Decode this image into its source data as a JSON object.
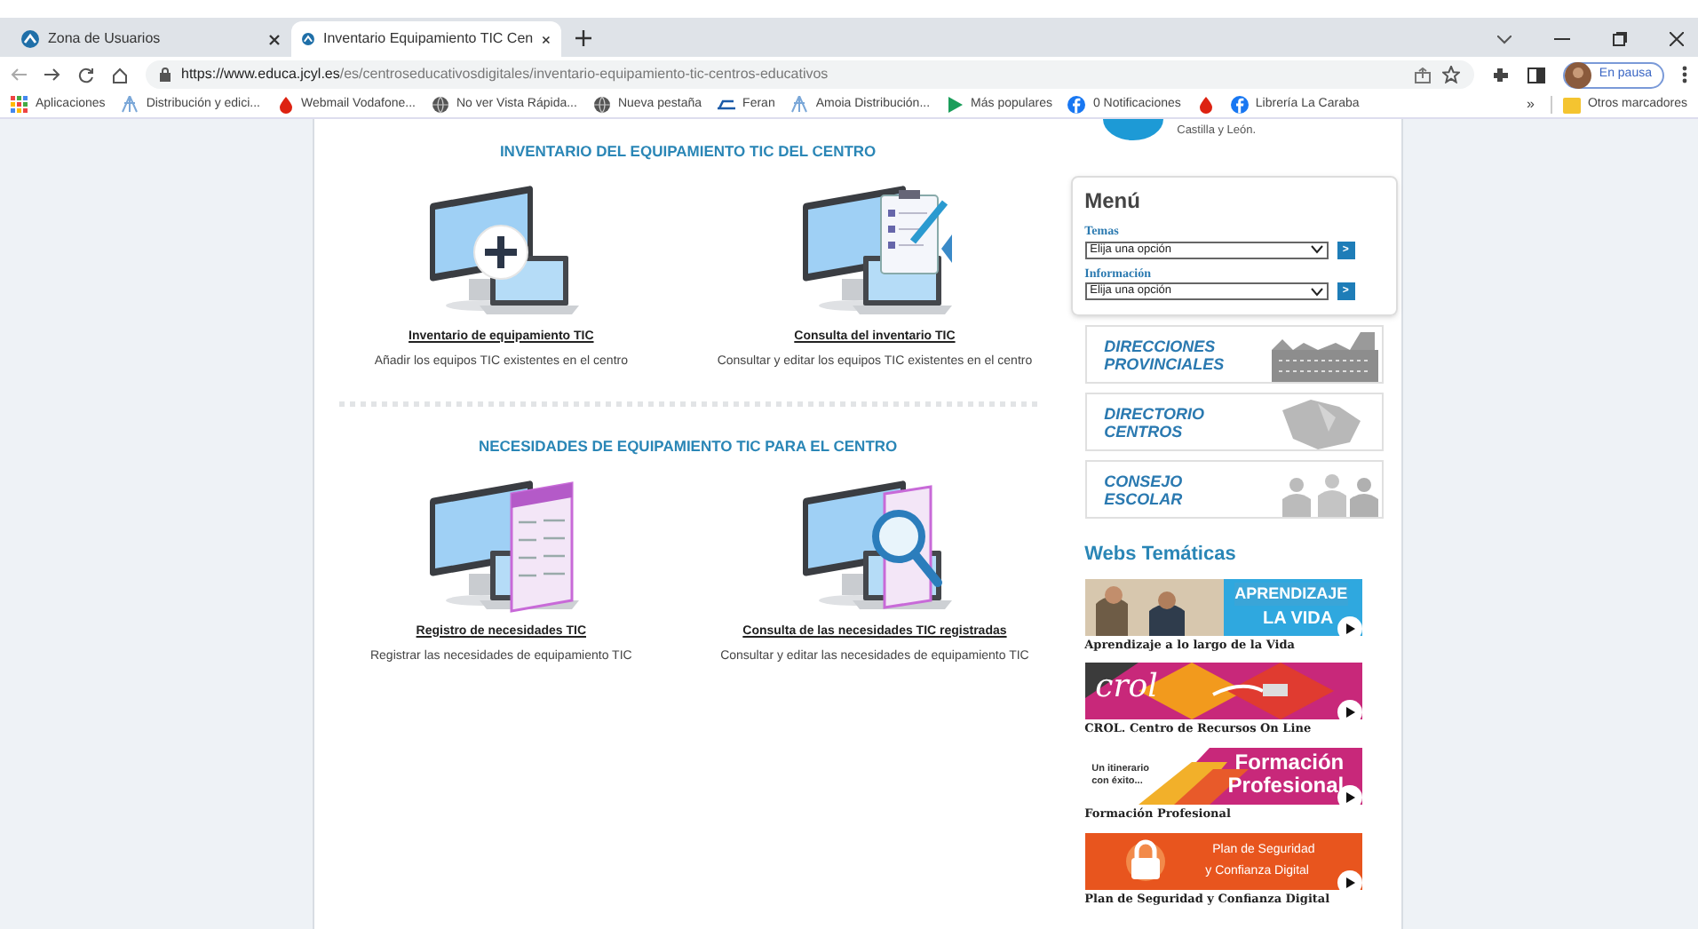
{
  "browser": {
    "tabs": [
      {
        "title": "Zona de Usuarios",
        "selected": false
      },
      {
        "title": "Inventario Equipamiento TIC Cen",
        "selected": true
      }
    ],
    "url_host": "https://www.educa.jcyl.es",
    "url_path": "/es/centroseducativosdigitales/inventario-equipamiento-tic-centros-educativos",
    "profile": "En pausa",
    "bookmarks": [
      {
        "kind": "apps",
        "label": "Aplicaciones"
      },
      {
        "kind": "tree",
        "label": "Distribución y edici..."
      },
      {
        "kind": "drop",
        "label": "Webmail Vodafone..."
      },
      {
        "kind": "globe",
        "label": "No ver Vista Rápida..."
      },
      {
        "kind": "globe",
        "label": "Nueva pestaña"
      },
      {
        "kind": "flag",
        "label": "Feran"
      },
      {
        "kind": "tree",
        "label": "Amoia Distribución..."
      },
      {
        "kind": "play",
        "label": "Más populares"
      },
      {
        "kind": "fb",
        "label": "0 Notificaciones"
      },
      {
        "kind": "drop"
      },
      {
        "kind": "fb",
        "label": "Librería La Caraba"
      }
    ],
    "more": "»",
    "other_bookmarks": "Otros marcadores"
  },
  "logo_text": "Castilla y León.",
  "sections": [
    {
      "title": "INVENTARIO DEL EQUIPAMIENTO TIC DEL CENTRO",
      "items": [
        {
          "kind": "plus",
          "link": "Inventario de equipamiento TIC",
          "description": "Añadir los equipos TIC existentes en el centro"
        },
        {
          "kind": "clipboard",
          "link": "Consulta del inventario TIC",
          "description": "Consultar y editar los equipos TIC existentes en el centro"
        }
      ]
    },
    {
      "title": "NECESIDADES DE EQUIPAMIENTO TIC PARA EL CENTRO",
      "items": [
        {
          "kind": "form",
          "link": "Registro de necesidades TIC",
          "description": "Registrar las necesidades de equipamiento TIC"
        },
        {
          "kind": "magnifier",
          "link": "Consulta de las necesidades TIC registradas",
          "description": "Consultar y editar las necesidades de equipamiento TIC"
        }
      ]
    }
  ],
  "menu": {
    "title": "Menú",
    "selects": [
      {
        "label": "Temas",
        "value": "Elija una opción",
        "button": ">"
      },
      {
        "label": "Información",
        "value": "Elija una opción",
        "button": ">"
      }
    ]
  },
  "image_links": [
    {
      "kind": "building",
      "lines": [
        "DIRECCIONES",
        "PROVINCIALES"
      ]
    },
    {
      "kind": "map",
      "lines": [
        "DIRECTORIO",
        "CENTROS"
      ]
    },
    {
      "kind": "people",
      "lines": [
        "CONSEJO",
        "ESCOLAR"
      ]
    }
  ],
  "webs_title": "Webs Temáticas",
  "webs": [
    {
      "kind": "aprendizaje",
      "banner_text": [
        "APRENDIZAJE",
        "LA VIDA"
      ],
      "caption": "Aprendizaje a lo largo de la Vida"
    },
    {
      "kind": "crol",
      "banner_text": [
        "crol"
      ],
      "caption": "CROL. Centro de Recursos On Line"
    },
    {
      "kind": "fp",
      "banner_text": [
        "Un itinerario con éxito...",
        "Formación Profesional"
      ],
      "caption": "Formación Profesional"
    },
    {
      "kind": "seguridad",
      "banner_text": [
        "Plan de Seguridad",
        "y Confianza Digital"
      ],
      "caption": "Plan de Seguridad y Confianza Digital"
    }
  ]
}
